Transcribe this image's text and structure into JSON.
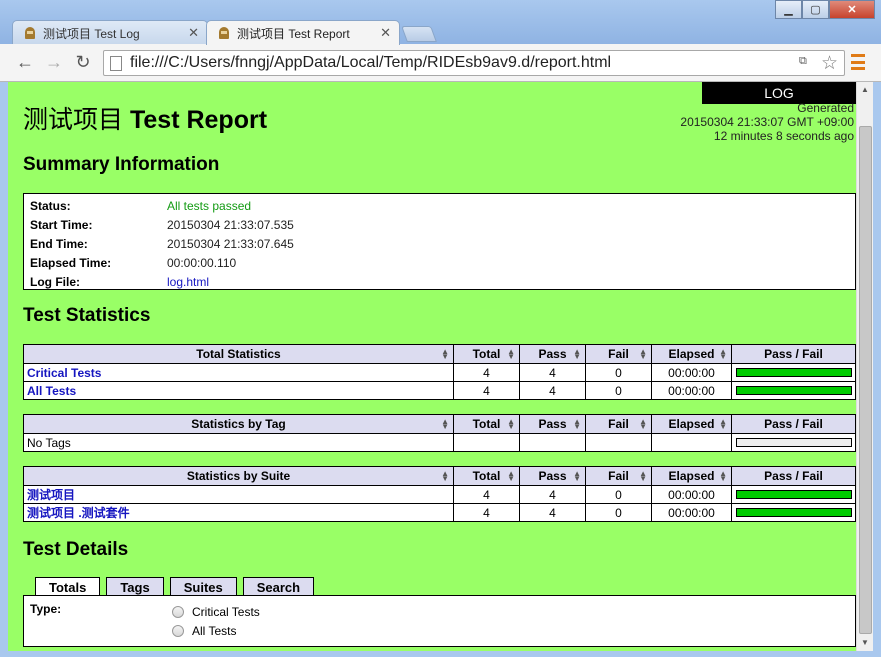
{
  "browser": {
    "tabs": [
      {
        "label": "测试项目 Test Log",
        "active": false
      },
      {
        "label": "测试项目 Test Report",
        "active": true
      }
    ],
    "url": "file:///C:/Users/fnngj/AppData/Local/Temp/RIDEsb9av9.d/report.html"
  },
  "report": {
    "log_button": "LOG",
    "generated": {
      "label": "Generated",
      "timestamp": "20150304 21:33:07 GMT +09:00",
      "ago": "12 minutes 8 seconds ago"
    },
    "title_cn": "测试项目",
    "title_en": "Test Report",
    "summary": {
      "heading": "Summary Information",
      "status_label": "Status:",
      "status_value": "All tests passed",
      "start_label": "Start Time:",
      "start_value": "20150304 21:33:07.535",
      "end_label": "End Time:",
      "end_value": "20150304 21:33:07.645",
      "elapsed_label": "Elapsed Time:",
      "elapsed_value": "00:00:00.110",
      "logfile_label": "Log File:",
      "logfile_value": "log.html"
    },
    "statistics": {
      "heading": "Test Statistics",
      "columns": [
        "Total",
        "Pass",
        "Fail",
        "Elapsed",
        "Pass / Fail"
      ],
      "total": {
        "header": "Total Statistics",
        "rows": [
          {
            "name": "Critical Tests",
            "total": "4",
            "pass": "4",
            "fail": "0",
            "elapsed": "00:00:00",
            "pass_fraction": 1.0
          },
          {
            "name": "All Tests",
            "total": "4",
            "pass": "4",
            "fail": "0",
            "elapsed": "00:00:00",
            "pass_fraction": 1.0
          }
        ]
      },
      "tag": {
        "header": "Statistics by Tag",
        "rows": [
          {
            "name": "No Tags",
            "total": "",
            "pass": "",
            "fail": "",
            "elapsed": "",
            "pass_fraction": 0
          }
        ]
      },
      "suite": {
        "header": "Statistics by Suite",
        "rows": [
          {
            "name": "测试项目",
            "total": "4",
            "pass": "4",
            "fail": "0",
            "elapsed": "00:00:00",
            "pass_fraction": 1.0
          },
          {
            "name": "测试项目 .测试套件",
            "total": "4",
            "pass": "4",
            "fail": "0",
            "elapsed": "00:00:00",
            "pass_fraction": 1.0
          }
        ]
      }
    },
    "details": {
      "heading": "Test Details",
      "tabs": [
        "Totals",
        "Tags",
        "Suites",
        "Search"
      ],
      "type_label": "Type:",
      "options": [
        "Critical Tests",
        "All Tests"
      ]
    }
  },
  "colors": {
    "page_bg": "#99ff66",
    "pass_bar": "#00cc00",
    "link": "#1515c0"
  }
}
